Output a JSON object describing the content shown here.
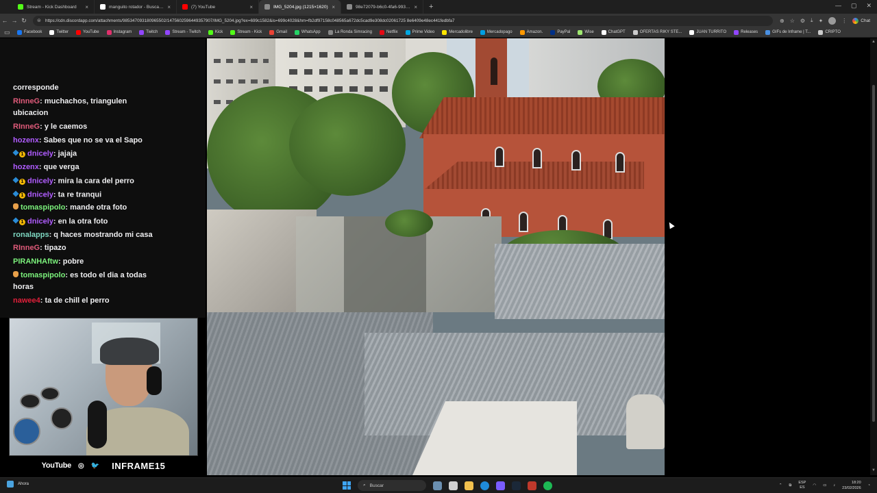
{
  "browser": {
    "tabs": [
      {
        "title": "Stream - Kick Dashboard",
        "color": "#53fc18",
        "active": false
      },
      {
        "title": "manguito rotador - Buscar con Google",
        "color": "#ffffff",
        "active": false
      },
      {
        "title": "(7) YouTube",
        "color": "#ff0000",
        "active": false
      },
      {
        "title": "IMG_5204.jpg (1215×1620)",
        "color": "#8a8a8a",
        "active": true
      },
      {
        "title": "98e72079-b6c0-4fa6-9930-1a5ce...",
        "color": "#8a8a8a",
        "active": false
      }
    ],
    "url": "https://cdn.discordapp.com/attachments/985347093180965502/1475602596449357907/IMG_5204.jpg?ex=699c1582&is=699c4028&hm=fb2df97158c048565a672dc5cad9e308dc02061725 8e6409e48ec441fedbfa7",
    "chat_label": "Chat",
    "bookmarks": [
      {
        "label": "Facebook",
        "color": "#1877f2"
      },
      {
        "label": "Twitter",
        "color": "#ffffff"
      },
      {
        "label": "YouTube",
        "color": "#ff0000"
      },
      {
        "label": "Instagram",
        "color": "#e1306c"
      },
      {
        "label": "Twitch",
        "color": "#9146ff"
      },
      {
        "label": "Stream - Twitch",
        "color": "#9146ff"
      },
      {
        "label": "Kick",
        "color": "#53fc18"
      },
      {
        "label": "Stream - Kick",
        "color": "#53fc18"
      },
      {
        "label": "Gmail",
        "color": "#ea4335"
      },
      {
        "label": "WhatsApp",
        "color": "#25d366"
      },
      {
        "label": "La Ronda Simracing",
        "color": "#888888"
      },
      {
        "label": "Netflix",
        "color": "#e50914"
      },
      {
        "label": "Prime Video",
        "color": "#00a8e1"
      },
      {
        "label": "Mercadolibre",
        "color": "#ffe600"
      },
      {
        "label": "Mercadopago",
        "color": "#009ee3"
      },
      {
        "label": "Amazon.",
        "color": "#ff9900"
      },
      {
        "label": "PayPal",
        "color": "#003087"
      },
      {
        "label": "Wise",
        "color": "#9fe870"
      },
      {
        "label": "ChatGPT",
        "color": "#ffffff"
      },
      {
        "label": "OFERTAS RIKY STE...",
        "color": "#cccccc"
      },
      {
        "label": "JUAN TURRITO",
        "color": "#ffffff"
      },
      {
        "label": "Releases",
        "color": "#9146ff"
      },
      {
        "label": "GIFs de Inframe | T...",
        "color": "#4a90e2"
      },
      {
        "label": "CRIPTO",
        "color": "#cccccc"
      }
    ]
  },
  "chat": {
    "messages": [
      {
        "user": "",
        "color": "#efeff1",
        "text": "corresponde",
        "badges": ""
      },
      {
        "user": "RInneG",
        "color": "#e05b7a",
        "text": ": muchachos, triangulen ubicacion",
        "badges": ""
      },
      {
        "user": "RInneG",
        "color": "#e05b7a",
        "text": ": y le caemos",
        "badges": ""
      },
      {
        "user": "hozenx",
        "color": "#b05cff",
        "text": ": Sabes que no se va el Sapo",
        "badges": ""
      },
      {
        "user": "dnicely",
        "color": "#b05cff",
        "text": ": jajaja",
        "badges": "sub"
      },
      {
        "user": "hozenx",
        "color": "#b05cff",
        "text": ": que verga",
        "badges": ""
      },
      {
        "user": "dnicely",
        "color": "#b05cff",
        "text": ": mira la cara del perro",
        "badges": "sub"
      },
      {
        "user": "dnicely",
        "color": "#b05cff",
        "text": ": ta re tranqui",
        "badges": "sub"
      },
      {
        "user": "tomaspipolo",
        "color": "#7cf27c",
        "text": ": mande otra foto",
        "badges": "hand"
      },
      {
        "user": "dnicely",
        "color": "#b05cff",
        "text": ": en la otra foto",
        "badges": "sub"
      },
      {
        "user": "ronalapps",
        "color": "#7ed8c2",
        "text": ": q haces mostrando mi casa",
        "badges": ""
      },
      {
        "user": "RInneG",
        "color": "#e05b7a",
        "text": ": tipazo",
        "badges": ""
      },
      {
        "user": "PIRANHAftw",
        "color": "#7cf27c",
        "text": ": pobre",
        "badges": ""
      },
      {
        "user": "tomaspipolo",
        "color": "#7cf27c",
        "text": ": es todo el dia a todas horas",
        "badges": "hand"
      },
      {
        "user": "nawee4",
        "color": "#e0203a",
        "text": ": ta de chill el perro",
        "badges": ""
      }
    ],
    "badge_digit": "1"
  },
  "overlay": {
    "youtube": "YouTube",
    "instagram": "◎",
    "twitter": "🐦",
    "channel": "INFRAME15"
  },
  "taskbar": {
    "weather": "Ahora",
    "search": "Buscar",
    "lang_top": "ESP",
    "lang_bottom": "ES",
    "time": "18:20",
    "date": "23/02/2026"
  }
}
